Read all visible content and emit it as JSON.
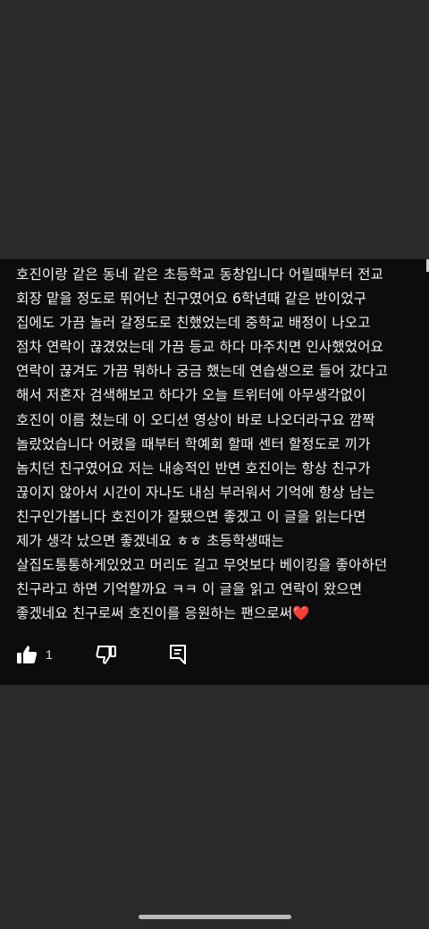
{
  "comment": {
    "lines": [
      "호진이랑 같은 동네 같은 초등학교 동창입니다 어릴때부터 전교",
      "회장 맡을 정도로 뛰어난 친구였어요 6학년때 같은 반이었구",
      "집에도 가끔 놀러 갈정도로 친했었는데 중학교 배정이 나오고",
      "점차 연락이 끊겼었는데 가끔 등교 하다 마주치면 인사했었어요",
      "연락이 끊겨도 가끔 뭐하나 궁금 했는데 연습생으로 들어 갔다고",
      "해서 저혼자 검색해보고 하다가 오늘 트위터에 아무생각없이",
      "호진이 이름 쳤는데 이 오디션 영상이 바로 나오더라구요 깜짝",
      "놀랐었습니다 어렸을 때부터 학예회 할때 센터 할정도로 끼가",
      "놈치던 친구였어요 저는 내송적인 반면 호진이는 항상 친구가",
      "끊이지 않아서 시간이 자나도 내심 부러워서 기억에 항상 남는",
      "친구인가봅니다 호진이가 잘됐으면 좋겠고 이 글을 읽는다면",
      "제가 생각 났으면 좋겠네요 ㅎㅎ 초등학생때는",
      "살집도통통하게있었고 머리도 길고 무엇보다 베이킹을 좋아하던",
      "친구라고 하면 기억할까요 ㅋㅋ 이 글을 읽고 연락이 왔으면",
      "좋겠네요 친구로써 호진이를 응원하는 팬으로써"
    ],
    "heart_emoji": "❤️"
  },
  "actions": {
    "like_icon": "thumbs-up-icon",
    "like_count": "1",
    "dislike_icon": "thumbs-down-icon",
    "reply_icon": "reply-icon"
  },
  "colors": {
    "background": "#2a2a2a",
    "card": "#0c0c0c",
    "text": "#f2f2f2",
    "heart": "#e0302e"
  }
}
